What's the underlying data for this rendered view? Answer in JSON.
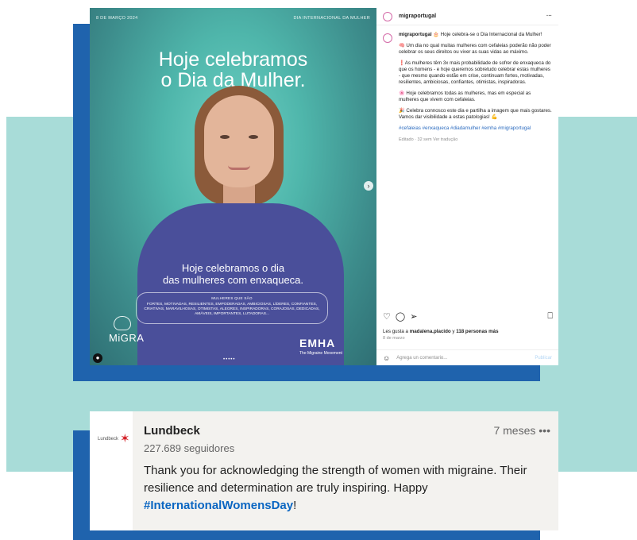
{
  "colors": {
    "teal_background": "#a8dcd8",
    "blue_accent": "#1f63ad",
    "linkedin_blue": "#0a66c2",
    "lundbeck_red": "#d41f26"
  },
  "instagram_post": {
    "image": {
      "date_label": "8 DE MARÇO 2024",
      "event_label": "DIA INTERNACIONAL DA MULHER",
      "headline_line1": "Hoje celebramos",
      "headline_line2": "o Dia da Mulher.",
      "subhead_line1": "Hoje celebramos o dia",
      "subhead_line2": "das mulheres com enxaqueca.",
      "pill_title": "MULHERES QUE SÃO",
      "pill_words": "FORTES, MOTIVADAS, RESILIENTES, EMPODERADAS, AMBICIOSAS, LÍDERES, CONFIANTES, CRIATIVAS, MARAVILHOSAS, OTIMISTAS, ALEGRES, INSPIRADORAS, CORAJOSAS, DEDICADAS, AMÁVEIS, IMPORTANTES, LUTADORAS...",
      "logo_left": "MiGRA",
      "logo_right": "EMHA",
      "logo_right_sub": "The Migraine Movement",
      "carousel_dots": "•••••"
    },
    "header": {
      "username": "migraportugal",
      "more_icon": "more-horizontal-icon"
    },
    "caption": {
      "username": "migraportugal",
      "intro": "🎂 Hoje celebra-se o Dia Internacional da Mulher!",
      "p1": "🧠 Um dia no qual muitas mulheres com cefaleias poderão não poder celebrar os seus direitos ou viver as suas vidas ao máximo.",
      "p2": "❗As mulheres têm 3x mais probabilidade de sofrer de enxaqueca do que os homens - e hoje queremos sobretudo celebrar estas mulheres - que mesmo quando estão em crise, continuam fortes, motivadas, resilientes, ambiciosas, confiantes, otimistas, inspiradoras.",
      "p3": "🌸 Hoje celebramos todas as mulheres, mas em especial as mulheres que vivem com cefaleias.",
      "p4": "🎉 Celebra connosco este dia e partilha a imagem que mais gostares. Vamos dar visibilidade a estas patologias! 💪",
      "hashtags": "#cefaleias #enxaqueca #diadamulher #emha #migraportugal",
      "meta": "Editado · 32 sem   Ver tradução"
    },
    "actions": {
      "like_icon": "heart-icon",
      "comment_icon": "comment-icon",
      "share_icon": "send-icon",
      "save_icon": "bookmark-icon"
    },
    "likes": {
      "prefix": "Les gusta a",
      "user": "madalena.placido",
      "middle": "y",
      "others": "118 personas más",
      "date": "8 de marzo"
    },
    "comment_box": {
      "placeholder": "Agrega un comentario...",
      "post_label": "Publicar"
    }
  },
  "linkedin_comment": {
    "logo_text": "Lundbeck",
    "author": "Lundbeck",
    "followers": "227.689 seguidores",
    "time": "7 meses",
    "more_label": "•••",
    "text": "Thank you for acknowledging the strength of women with migraine. Their resilience and determination are truly inspiring. Happy",
    "hashtag": "#InternationalWomensDay",
    "suffix": "!"
  }
}
